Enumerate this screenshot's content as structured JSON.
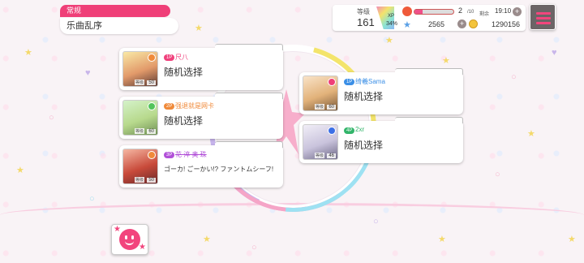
{
  "mode": {
    "tag": "常规",
    "song": "乐曲乱序"
  },
  "status": {
    "level_label": "等级",
    "level": "161",
    "xp_label": "XP",
    "xp_percent": "34%",
    "stamina_count": "2",
    "stamina_max": "/10",
    "stamina_fraction": 0.2,
    "remain_label": "剩余",
    "remain_time": "19:10",
    "gems": "2565",
    "coins": "1290156"
  },
  "players": [
    {
      "rank": "1P",
      "name": "尺八",
      "song": "随机选择",
      "level": "50",
      "level_label": "等级",
      "rank_color": "#f0417c",
      "name_color": "#f0417c",
      "attr_color": "#f08a3a"
    },
    {
      "rank": "2P",
      "name": "强退就是网卡",
      "song": "随机选择",
      "level": "60",
      "level_label": "等级",
      "rank_color": "#f08a3a",
      "name_color": "#f08a3a",
      "attr_color": "#52c45a"
    },
    {
      "rank": "3P",
      "name": "花 淬 奥 珠",
      "song": "ゴーカ! ごーかい!? ファントムシーフ!",
      "level": "50",
      "level_label": "等级",
      "rank_color": "#b14fd8",
      "name_color": "#b14fd8",
      "attr_color": "#f08a3a"
    },
    {
      "rank": "1P",
      "name": "绮羲Sama",
      "song": "随机选择",
      "level": "60",
      "level_label": "等级",
      "rank_color": "#3b8fe6",
      "name_color": "#3b8fe6",
      "attr_color": "#ef3f78"
    },
    {
      "rank": "4P",
      "name": "2xr",
      "song": "随机选择",
      "level": "46",
      "level_label": "等级",
      "rank_color": "#32b56a",
      "name_color": "#32b56a",
      "attr_color": "#3b6fe6"
    }
  ]
}
